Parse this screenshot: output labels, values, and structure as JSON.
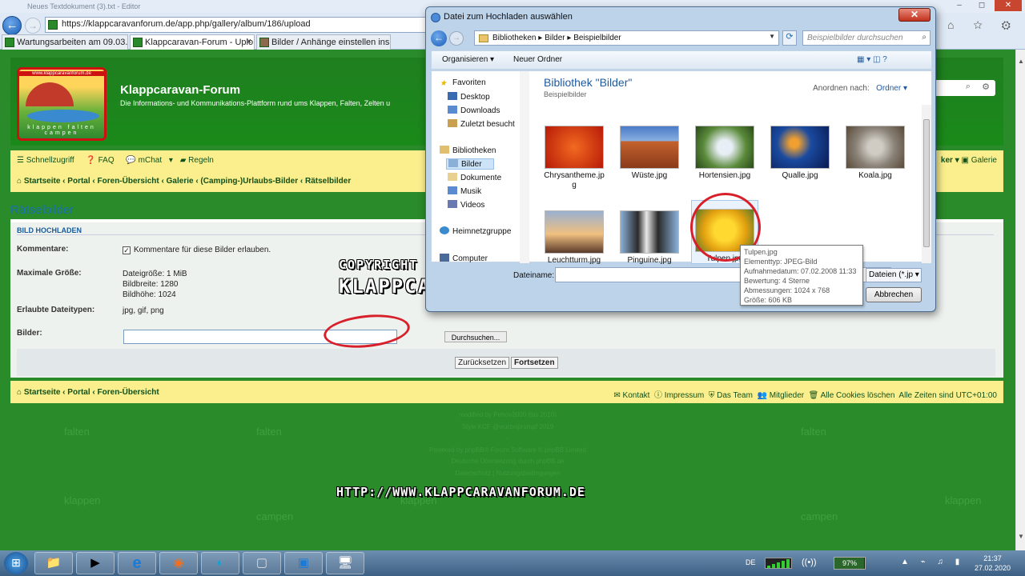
{
  "browser": {
    "window_title": "Neues Textdokument (3).txt - Editor",
    "url": "https://klappcaravanforum.de/app.php/gallery/album/186/upload",
    "tabs": [
      {
        "label": "Wartungsarbeiten am 09.03.20..."
      },
      {
        "label": "Klappcaravan-Forum - Uplo..."
      },
      {
        "label": "Bilder / Anhänge einstellen ins ..."
      }
    ],
    "tab_close": "×",
    "search_dropdown": "⌕▾",
    "tools": "⌂ ☆ ⚙"
  },
  "site": {
    "logo_url": "www.klappcaravanforum.de",
    "logo_words": "klappen falten campen",
    "title": "Klappcaravan-Forum",
    "description": "Die Informations- und Kommunikations-Plattform rund ums Klappen, Falten, Zelten u",
    "nav": {
      "quicklinks": [
        "Schnellzugriff",
        "FAQ",
        "mChat",
        "Regeln"
      ],
      "right": [
        "ker ▾",
        "Galerie"
      ],
      "breadcrumbs": "Startseite ‹ Portal ‹ Foren-Übersicht ‹ Galerie ‹ (Camping-)Urlaubs-Bilder ‹ Rätselbilder"
    }
  },
  "upload": {
    "page_heading": "Rätselbilder",
    "panel_heading": "BILD HOCHLADEN",
    "comments_label": "Kommentare:",
    "comments_checkbox": "Kommentare für diese Bilder erlauben.",
    "comments_checked": true,
    "maxsize_label": "Maximale Größe:",
    "maxsize_lines": [
      "Dateigröße: 1 MiB",
      "Bildbreite: 1280",
      "Bildhöhe: 1024"
    ],
    "types_label": "Erlaubte Dateitypen:",
    "types_value": "jpg, gif, png",
    "images_label": "Bilder:",
    "browse_button": "Durchsuchen...",
    "reset_button": "Zurücksetzen",
    "submit_button": "Fortsetzen"
  },
  "footer": {
    "left": "Startseite ‹ Portal ‹ Foren-Übersicht",
    "right": [
      "Kontakt",
      "Impressum",
      "Das Team",
      "Mitglieder",
      "Alle Cookies löschen",
      "Alle Zeiten sind UTC+01:00"
    ],
    "credits": [
      "modified by Petrov2000 (bis 2010)",
      "Style KCF @wurzelprumpf 2019",
      "-",
      "Powered by phpBB® Forum Software © phpBB Limited",
      "Deutsche Übersetzung durch phpBB.de",
      "Datenschutz | Nutzungsbedingungen"
    ],
    "watermark_words": [
      "falten",
      "klappen",
      "campen"
    ]
  },
  "overlay": {
    "copyright_line1": "COPYRIGHT BY:",
    "copyright_line2": "KLAPPCARAVAN-FORUM",
    "url_mark": "HTTP://WWW.KLAPPCARAVANFORUM.DE"
  },
  "dialog": {
    "title": "Datei zum Hochladen auswählen",
    "close": "✕",
    "path": [
      "Bibliotheken",
      "Bilder",
      "Beispielbilder"
    ],
    "search_placeholder": "Beispielbilder durchsuchen",
    "toolbar": {
      "organize": "Organisieren ▾",
      "new_folder": "Neuer Ordner",
      "view_icons": "▦ ▾  ◫  ?"
    },
    "tree": [
      {
        "label": "Favoriten"
      },
      {
        "label": "Desktop"
      },
      {
        "label": "Downloads"
      },
      {
        "label": "Zuletzt besucht"
      },
      {
        "label": "Bibliotheken"
      },
      {
        "label": "Bilder"
      },
      {
        "label": "Dokumente"
      },
      {
        "label": "Musik"
      },
      {
        "label": "Videos"
      },
      {
        "label": "Heimnetzgruppe"
      },
      {
        "label": "Computer"
      }
    ],
    "library_title": "Bibliothek \"Bilder\"",
    "library_sub": "Beispielbilder",
    "arrange_label": "Anordnen nach:",
    "arrange_value": "Ordner ▾",
    "files": [
      {
        "name": "Chrysanthemum.jpg",
        "wrap": "Chrysantheme.jp",
        "wrap2": "g",
        "color": "#d83010"
      },
      {
        "name": "Wüste.jpg",
        "color": "#b4552a"
      },
      {
        "name": "Hortensien.jpg",
        "color": "#5a8a3a"
      },
      {
        "name": "Qualle.jpg",
        "color": "#1a3a8a"
      },
      {
        "name": "Koala.jpg",
        "color": "#8a8278"
      },
      {
        "name": "Leuchtturm.jpg",
        "color": "#6a80a8"
      },
      {
        "name": "Pinguine.jpg",
        "color": "#7a9ac0"
      },
      {
        "name": "Tulpen.jpg",
        "color": "#e2b010"
      }
    ],
    "filename_label": "Dateiname:",
    "filter": "Dateien (*.jp ▾",
    "cancel": "Abbrechen",
    "tooltip": [
      "Tulpen.jpg",
      "Elementtyp: JPEG-Bild",
      "Aufnahmedatum: 07.02.2008 11:33",
      "Bewertung: 4 Sterne",
      "Abmessungen: 1024 x 768",
      "Größe: 606 KB"
    ]
  },
  "taskbar": {
    "start": "⊞",
    "apps": [
      "📁",
      "▶",
      "e",
      "◉",
      "◐",
      "▢",
      "▣",
      "🖥"
    ],
    "language": "DE",
    "battery": "97%",
    "battery_level": 0.97,
    "tray_icons": "▲ ⌁ ♫ ▮",
    "time": "21:37",
    "date": "27.02.2020"
  }
}
